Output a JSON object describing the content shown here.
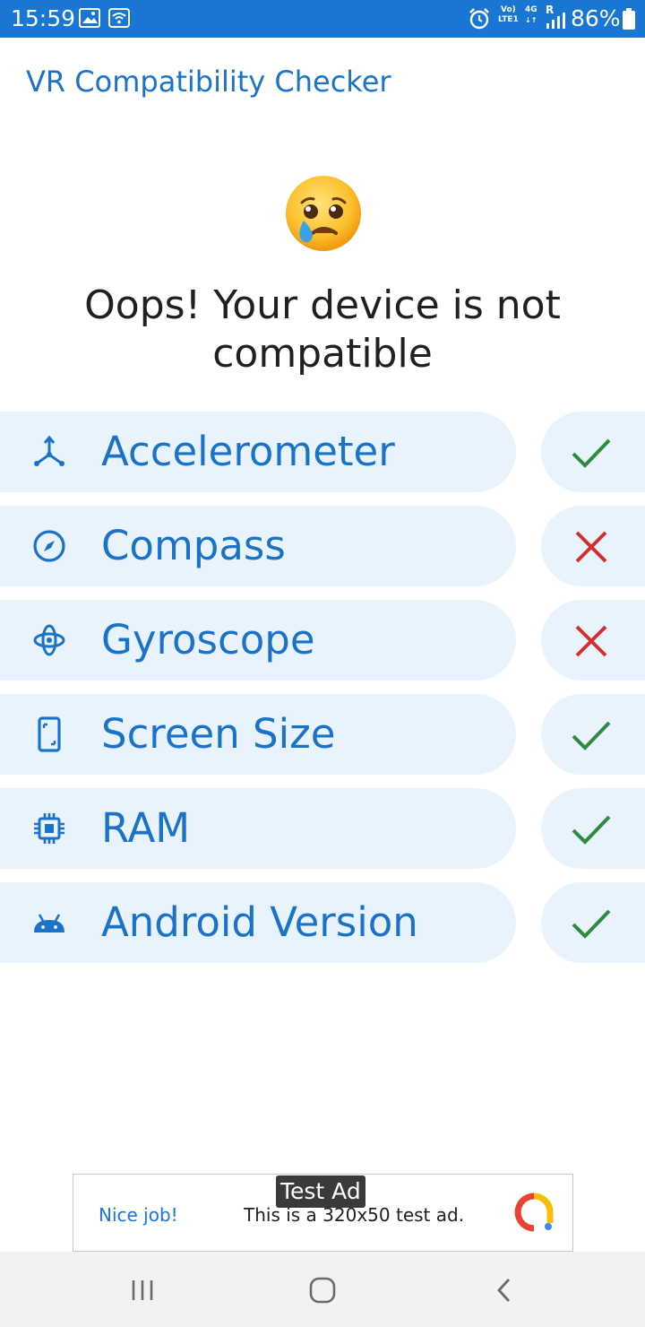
{
  "status_bar": {
    "time": "15:59",
    "network_top": "Vo)",
    "network_bottom": "LTE1",
    "network_type": "4G",
    "roaming": "R",
    "battery": "86%",
    "icons": [
      "image-icon",
      "wifi-icon",
      "alarm-icon",
      "signal-icon",
      "battery-icon"
    ]
  },
  "app_bar": {
    "title": "VR Compatibility Checker"
  },
  "hero": {
    "emoji_icon": "crying-face-icon",
    "headline_line1": "Oops! Your device is not",
    "headline_line2": "compatible"
  },
  "checks": [
    {
      "label": "Accelerometer",
      "icon": "axes-icon",
      "status": "pass"
    },
    {
      "label": "Compass",
      "icon": "compass-icon",
      "status": "fail"
    },
    {
      "label": "Gyroscope",
      "icon": "gyroscope-icon",
      "status": "fail"
    },
    {
      "label": "Screen Size",
      "icon": "phone-screen-icon",
      "status": "pass"
    },
    {
      "label": "RAM",
      "icon": "chip-icon",
      "status": "pass"
    },
    {
      "label": "Android Version",
      "icon": "android-icon",
      "status": "pass"
    }
  ],
  "ad": {
    "badge": "Test Ad",
    "cta": "Nice job!",
    "text": "This is a 320x50 test ad."
  },
  "nav_bar": {
    "buttons": [
      "recents-button",
      "home-button",
      "back-button"
    ]
  },
  "colors": {
    "primary": "#1976d2",
    "label_blue": "#1a73c8",
    "pill_bg": "#e8f3fd",
    "pass_green": "#2e8b3d",
    "fail_red": "#d32f2f"
  }
}
